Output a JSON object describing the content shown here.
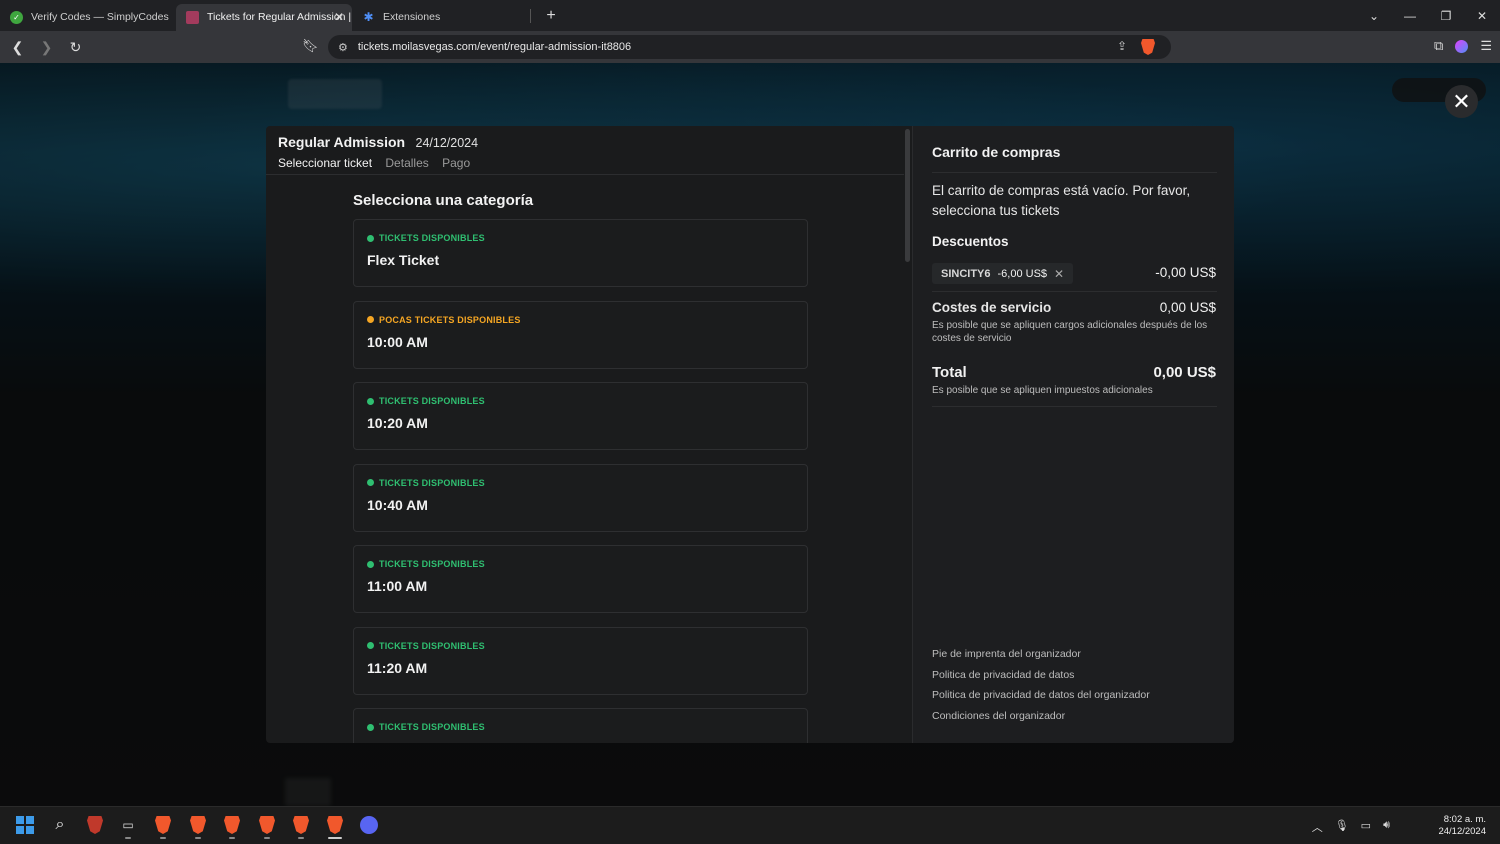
{
  "browser": {
    "tabs": [
      {
        "title": "Verify Codes — SimplyCodes",
        "icon": "simplycodes-check-icon",
        "active": false
      },
      {
        "title": "Tickets for Regular Admission |",
        "icon": "moi-favicon-icon",
        "active": true
      },
      {
        "title": "Extensiones",
        "icon": "puzzle-piece-icon",
        "active": false
      }
    ],
    "new_tab": "+",
    "url": "tickets.moilasvegas.com/event/regular-admission-it8806"
  },
  "event": {
    "title": "Regular Admission",
    "date": "24/12/2024",
    "steps": [
      "Seleccionar ticket",
      "Detalles",
      "Pago"
    ],
    "active_step": 0
  },
  "categories": {
    "heading": "Selecciona una categoría",
    "items": [
      {
        "status": "TICKETS DISPONIBLES",
        "status_color": "#2fbf71",
        "name": "Flex Ticket"
      },
      {
        "status": "POCAS TICKETS DISPONIBLES",
        "status_color": "#f5a623",
        "name": "10:00 AM"
      },
      {
        "status": "TICKETS DISPONIBLES",
        "status_color": "#2fbf71",
        "name": "10:20 AM"
      },
      {
        "status": "TICKETS DISPONIBLES",
        "status_color": "#2fbf71",
        "name": "10:40 AM"
      },
      {
        "status": "TICKETS DISPONIBLES",
        "status_color": "#2fbf71",
        "name": "11:00 AM"
      },
      {
        "status": "TICKETS DISPONIBLES",
        "status_color": "#2fbf71",
        "name": "11:20 AM"
      },
      {
        "status": "TICKETS DISPONIBLES",
        "status_color": "#2fbf71",
        "name": ""
      }
    ]
  },
  "cart": {
    "title": "Carrito de compras",
    "empty_message": "El carrito de compras está vacío. Por favor, selecciona tus tickets",
    "discounts_title": "Descuentos",
    "coupon_code": "SINCITY6",
    "coupon_amount": "-6,00 US$",
    "discount_total": "-0,00 US$",
    "service_label": "Costes de servicio",
    "service_value": "0,00 US$",
    "service_note": "Es posible que se apliquen cargos adicionales después de los costes de servicio",
    "total_label": "Total",
    "total_value": "0,00 US$",
    "total_note": "Es posible que se apliquen impuestos adicionales"
  },
  "footer_links": [
    "Pie de imprenta del organizador",
    "Politica de privacidad de datos",
    "Politica de privacidad de datos del organizador",
    "Condiciones del organizador"
  ],
  "taskbar": {
    "time": "8:02 a. m.",
    "date": "24/12/2024"
  }
}
